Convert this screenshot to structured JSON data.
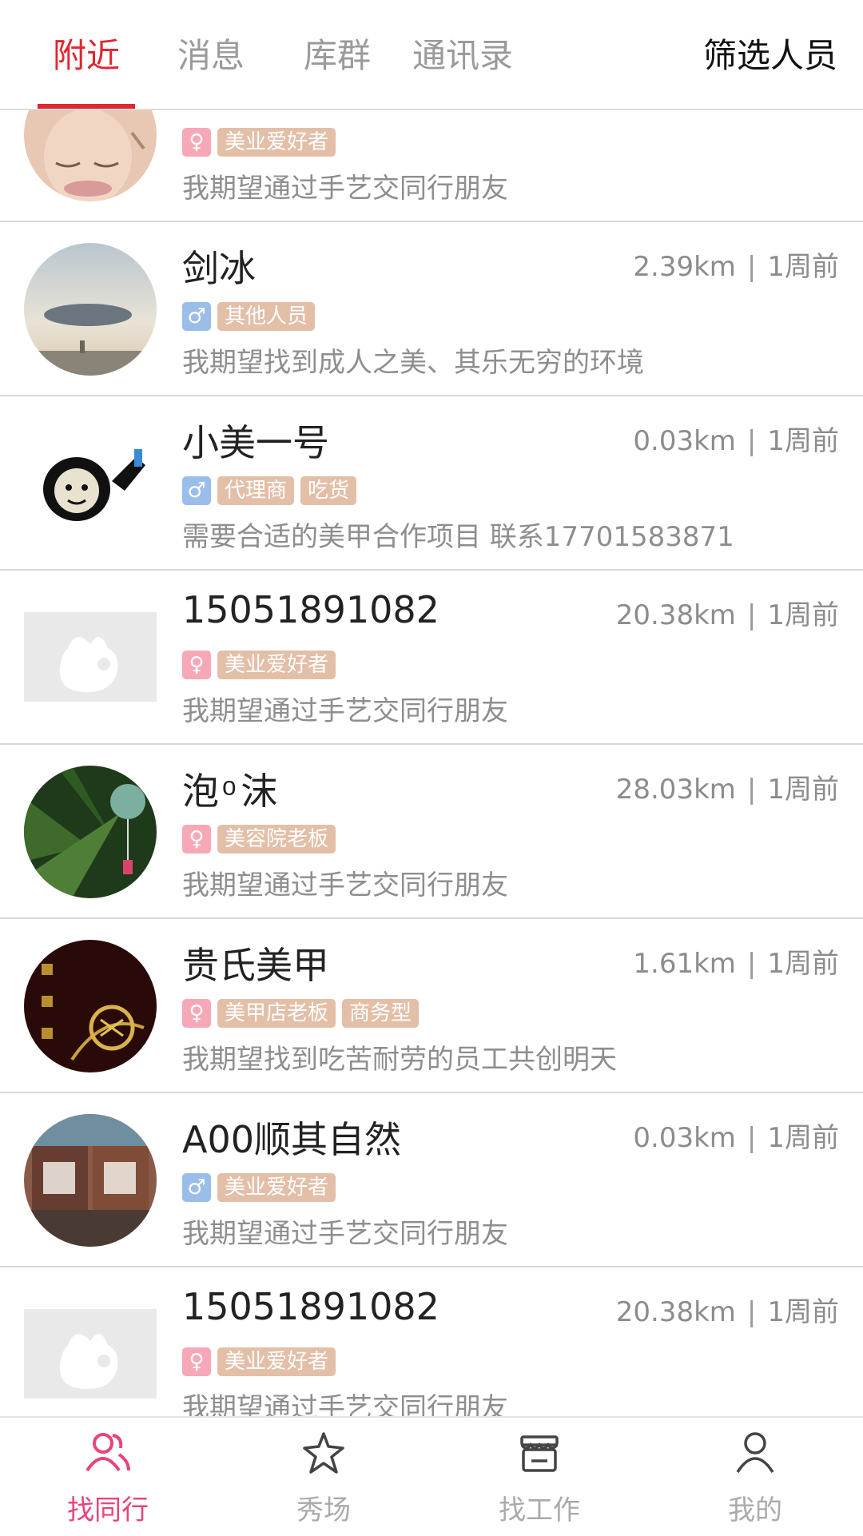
{
  "header": {
    "tabs": [
      {
        "label": "附近",
        "active": true
      },
      {
        "label": "消息",
        "active": false
      },
      {
        "label": "库群",
        "active": false
      },
      {
        "label": "通讯录",
        "active": false
      }
    ],
    "filter_label": "筛选人员",
    "accent_color": "#e0262f"
  },
  "list": {
    "items": [
      {
        "name": "",
        "distance": "",
        "time": "",
        "gender": "female",
        "tags": [
          "美业爱好者"
        ],
        "desc": "我期望通过手艺交同行朋友",
        "avatar": "woman-face-photo"
      },
      {
        "name": "剑冰",
        "distance": "2.39km",
        "time": "1周前",
        "gender": "male",
        "tags": [
          "其他人员"
        ],
        "desc": "我期望找到成人之美、其乐无穷的环境",
        "avatar": "sky-cloud-photo"
      },
      {
        "name": "小美一号",
        "distance": "0.03km",
        "time": "1周前",
        "gender": "male",
        "tags": [
          "代理商",
          "吃货"
        ],
        "desc": "需要合适的美甲合作项目 联系17701583871",
        "avatar": "panda-meme"
      },
      {
        "name": "15051891082",
        "distance": "20.38km",
        "time": "1周前",
        "gender": "female",
        "tags": [
          "美业爱好者"
        ],
        "desc": "我期望通过手艺交同行朋友",
        "avatar": "default-hand-placeholder"
      },
      {
        "name": "泡 ͦ 沫",
        "distance": "28.03km",
        "time": "1周前",
        "gender": "female",
        "tags": [
          "美容院老板"
        ],
        "desc": "我期望通过手艺交同行朋友",
        "avatar": "wind-chime-bamboo-photo"
      },
      {
        "name": "贵氏美甲",
        "distance": "1.61km",
        "time": "1周前",
        "gender": "female",
        "tags": [
          "美甲店老板",
          "商务型"
        ],
        "desc": "我期望找到吃苦耐劳的员工共创明天",
        "avatar": "gold-chinese-art"
      },
      {
        "name": "A00顺其自然",
        "distance": "0.03km",
        "time": "1周前",
        "gender": "male",
        "tags": [
          "美业爱好者"
        ],
        "desc": "我期望通过手艺交同行朋友",
        "avatar": "calligraphy-shunqiziran"
      },
      {
        "name": "15051891082",
        "distance": "20.38km",
        "time": "1周前",
        "gender": "female",
        "tags": [
          "美业爱好者"
        ],
        "desc": "我期望通过手艺交同行朋友",
        "avatar": "default-hand-placeholder"
      }
    ],
    "separator": "|",
    "colors": {
      "female": "#f7a8b8",
      "male": "#9bbde9",
      "tag": "#e3bfa8"
    }
  },
  "bottom_nav": {
    "items": [
      {
        "label": "找同行",
        "icon": "people-icon",
        "active": true
      },
      {
        "label": "秀场",
        "icon": "star-icon",
        "active": false
      },
      {
        "label": "找工作",
        "icon": "shop-icon",
        "active": false
      },
      {
        "label": "我的",
        "icon": "person-icon",
        "active": false
      }
    ],
    "active_color": "#e8447a"
  }
}
